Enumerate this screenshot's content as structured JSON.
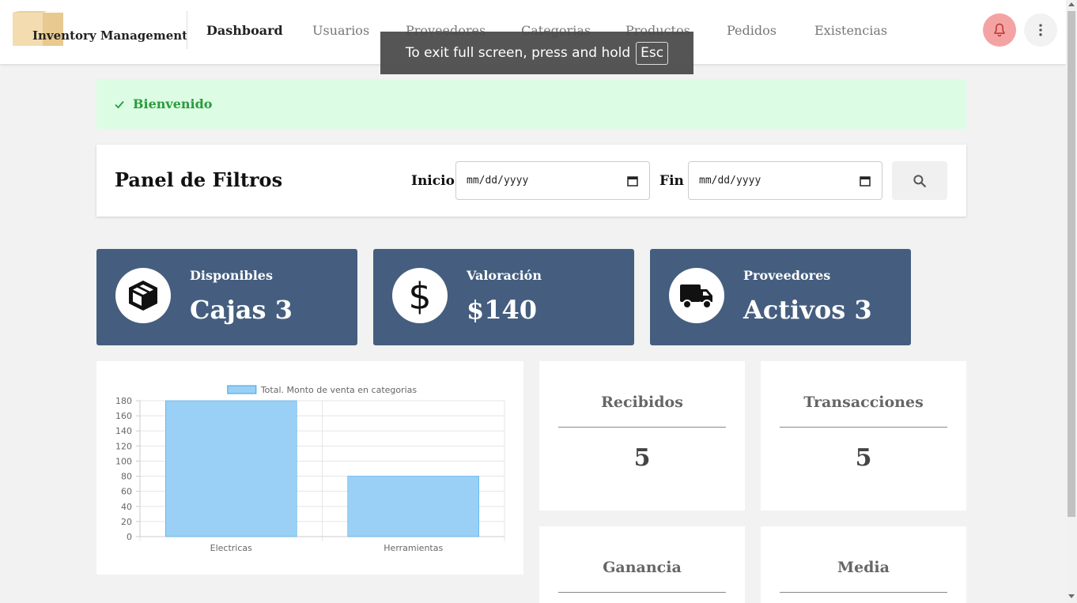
{
  "app": {
    "brand": "Inventory Management"
  },
  "nav": {
    "items": [
      {
        "label": "Dashboard",
        "active": true
      },
      {
        "label": "Usuarios"
      },
      {
        "label": "Proveedores"
      },
      {
        "label": "Categorias"
      },
      {
        "label": "Productos"
      },
      {
        "label": "Pedidos"
      },
      {
        "label": "Existencias"
      }
    ],
    "notifications_icon": "bell-icon",
    "more_icon": "more-vert-icon"
  },
  "fullscreen_toast": {
    "text": "To exit full screen, press and hold",
    "key": "Esc"
  },
  "alert": {
    "text": "Bienvenido",
    "icon": "check-icon",
    "color": "#2a9a3e",
    "background": "#dcfde3"
  },
  "filters": {
    "title": "Panel de Filtros",
    "start_label": "Inicio",
    "start_placeholder": "mm/dd/yyyy",
    "end_label": "Fin",
    "end_placeholder": "mm/dd/yyyy",
    "search_icon": "search-icon"
  },
  "stats": [
    {
      "label": "Disponibles",
      "value": "Cajas 3",
      "icon": "box-icon"
    },
    {
      "label": "Valoración",
      "value": "$140",
      "icon": "dollar-icon"
    },
    {
      "label": "Proveedores",
      "value": "Activos 3",
      "icon": "truck-icon"
    }
  ],
  "stat_color": "#455e7f",
  "metrics": [
    {
      "title": "Recibidos",
      "value": "5"
    },
    {
      "title": "Transacciones",
      "value": "5"
    },
    {
      "title": "Ganancia",
      "value": ""
    },
    {
      "title": "Media",
      "value": ""
    }
  ],
  "chart_data": {
    "type": "bar",
    "categories": [
      "Electricas",
      "Herramientas"
    ],
    "series": [
      {
        "name": "Total. Monto de venta en categorias",
        "values": [
          180,
          80
        ],
        "color": "#9ad0f5",
        "border": "#36a2eb"
      }
    ],
    "ylim": [
      0,
      180
    ],
    "yticks": [
      0,
      20,
      40,
      60,
      80,
      100,
      120,
      140,
      160,
      180
    ],
    "grid": true,
    "legend": "top"
  }
}
